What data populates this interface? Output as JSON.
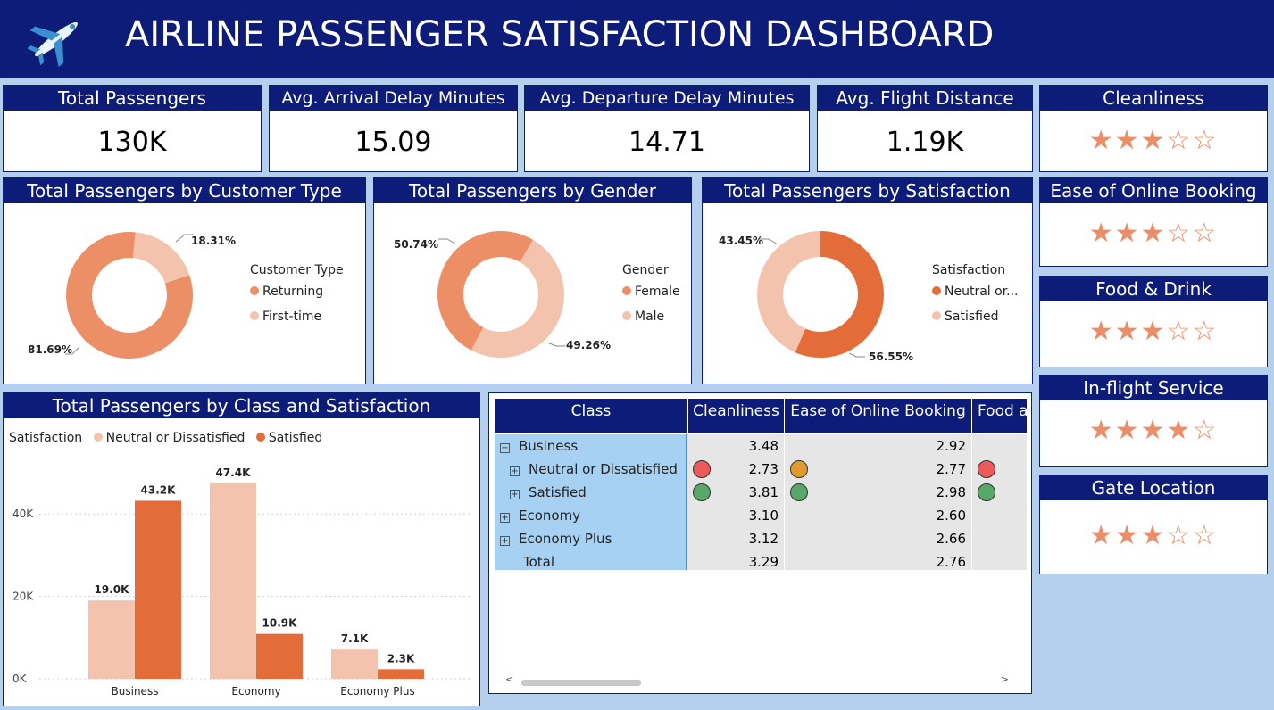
{
  "header": {
    "title": "AIRLINE PASSENGER SATISFACTION DASHBOARD",
    "icon": "airplane-icon"
  },
  "kpis": [
    {
      "label": "Total Passengers",
      "value": "130K"
    },
    {
      "label": "Avg. Arrival Delay Minutes",
      "value": "15.09"
    },
    {
      "label": "Avg. Departure Delay Minutes",
      "value": "14.71"
    },
    {
      "label": "Avg. Flight Distance",
      "value": "1.19K"
    }
  ],
  "ratings": [
    {
      "label": "Cleanliness",
      "stars": "★★★☆☆",
      "filled": 3
    },
    {
      "label": "Ease of Online Booking",
      "stars": "★★★☆☆",
      "filled": 3
    },
    {
      "label": "Food & Drink",
      "stars": "★★★☆☆",
      "filled": 3
    },
    {
      "label": "In-flight Service",
      "stars": "★★★★☆",
      "filled": 4
    },
    {
      "label": "Gate Location",
      "stars": "★★★☆☆",
      "filled": 3
    }
  ],
  "donuts": {
    "customer_type": {
      "title": "Total Passengers by Customer Type",
      "legend_title": "Customer Type",
      "labels": [
        "Returning",
        "First-time"
      ],
      "pct_labels": [
        "81.69%",
        "18.31%"
      ]
    },
    "gender": {
      "title": "Total Passengers by Gender",
      "legend_title": "Gender",
      "labels": [
        "Female",
        "Male"
      ],
      "pct_labels": [
        "50.74%",
        "49.26%"
      ]
    },
    "satisfaction": {
      "title": "Total Passengers by Satisfaction",
      "legend_title": "Satisfaction",
      "labels": [
        "Neutral or...",
        "Satisfied"
      ],
      "pct_labels": [
        "56.55%",
        "43.45%"
      ]
    }
  },
  "bar": {
    "title": "Total Passengers by Class and Satisfaction",
    "legend_title": "Satisfaction",
    "series_names": [
      "Neutral or Dissatisfied",
      "Satisfied"
    ],
    "ticks": [
      "0K",
      "20K",
      "40K"
    ],
    "categories": [
      "Business",
      "Economy",
      "Economy Plus"
    ],
    "labels_neutral": [
      "19.0K",
      "47.4K",
      "7.1K"
    ],
    "labels_satisfied": [
      "43.2K",
      "10.9K",
      "2.3K"
    ]
  },
  "matrix": {
    "headers": [
      "Class",
      "Cleanliness",
      "Ease of Online Booking",
      "Food a"
    ],
    "rows": [
      {
        "label": "Business",
        "clean": "3.48",
        "ease": "2.92",
        "expand": "−"
      },
      {
        "label": "Neutral or Dissatisfied",
        "clean": "2.73",
        "ease": "2.77",
        "expand": "+"
      },
      {
        "label": "Satisfied",
        "clean": "3.81",
        "ease": "2.98",
        "expand": "+"
      },
      {
        "label": "Economy",
        "clean": "3.10",
        "ease": "2.60",
        "expand": "+"
      },
      {
        "label": "Economy Plus",
        "clean": "3.12",
        "ease": "2.66",
        "expand": "+"
      },
      {
        "label": "Total",
        "clean": "3.29",
        "ease": "2.76",
        "expand": ""
      }
    ],
    "scroll_left": "<",
    "scroll_right": ">"
  },
  "colors": {
    "navy": "#0c1c78",
    "orange_dark": "#e46c39",
    "orange_mid": "#ec8f66",
    "peach": "#f3c3ad",
    "star": "#e98e69",
    "red_dot": "#ec5a5a",
    "amber_dot": "#e09a2e",
    "green_dot": "#58a86a"
  },
  "chart_data": [
    {
      "type": "pie",
      "title": "Total Passengers by Customer Type",
      "categories": [
        "Returning",
        "First-time"
      ],
      "values": [
        81.69,
        18.31
      ]
    },
    {
      "type": "pie",
      "title": "Total Passengers by Gender",
      "categories": [
        "Female",
        "Male"
      ],
      "values": [
        50.74,
        49.26
      ]
    },
    {
      "type": "pie",
      "title": "Total Passengers by Satisfaction",
      "categories": [
        "Neutral or Dissatisfied",
        "Satisfied"
      ],
      "values": [
        56.55,
        43.45
      ]
    },
    {
      "type": "bar",
      "title": "Total Passengers by Class and Satisfaction",
      "categories": [
        "Business",
        "Economy",
        "Economy Plus"
      ],
      "series": [
        {
          "name": "Neutral or Dissatisfied",
          "values": [
            19000,
            47400,
            7100
          ]
        },
        {
          "name": "Satisfied",
          "values": [
            43200,
            10900,
            2300
          ]
        }
      ],
      "ylim": [
        0,
        47400
      ],
      "legend": "top-left",
      "grid": true
    }
  ]
}
